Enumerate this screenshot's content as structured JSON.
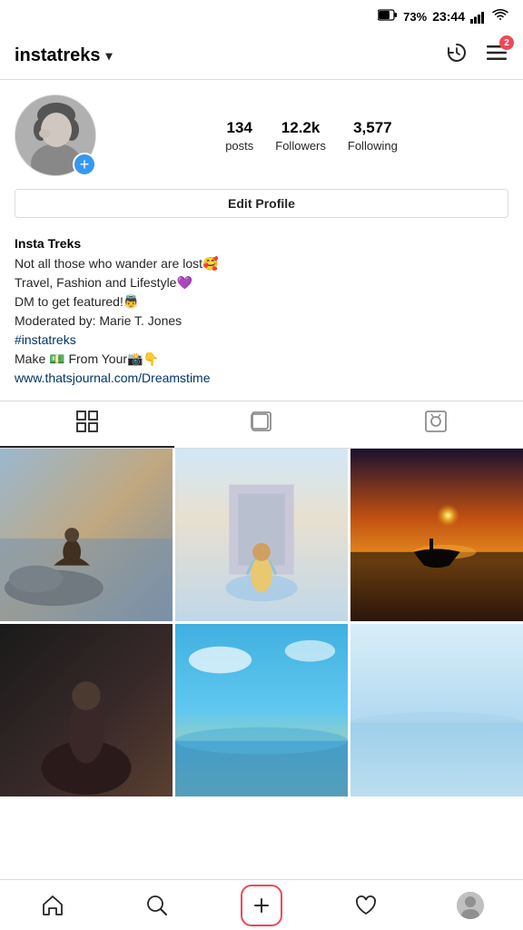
{
  "status_bar": {
    "battery": "73%",
    "time": "23:44"
  },
  "top_nav": {
    "username": "instatreks",
    "dropdown_icon": "▾",
    "history_icon": "⟳",
    "menu_icon": "≡",
    "notification_count": "2"
  },
  "profile": {
    "stats": {
      "posts_count": "134",
      "posts_label": "posts",
      "followers_count": "12.2k",
      "followers_label": "Followers",
      "following_count": "3,577",
      "following_label": "Following"
    },
    "edit_button": "Edit Profile",
    "bio": {
      "name": "Insta Treks",
      "line1": "Not all those who wander are lost🥰",
      "line2": "Travel, Fashion and Lifestyle💜",
      "line3": "DM to get featured!👼",
      "line4": "Moderated by: Marie T. Jones",
      "hashtag": "#instatreks",
      "promo": "Make 💵 From Your📸👇",
      "link": "www.thatsjournal.com/Dreamstime"
    }
  },
  "tabs": [
    {
      "id": "grid",
      "label": "Grid",
      "active": true
    },
    {
      "id": "video",
      "label": "Video",
      "active": false
    },
    {
      "id": "tagged",
      "label": "Tagged",
      "active": false
    }
  ],
  "bottom_nav": [
    {
      "id": "home",
      "label": "Home"
    },
    {
      "id": "search",
      "label": "Search"
    },
    {
      "id": "add",
      "label": "Add"
    },
    {
      "id": "heart",
      "label": "Activity"
    },
    {
      "id": "profile",
      "label": "Profile"
    }
  ]
}
